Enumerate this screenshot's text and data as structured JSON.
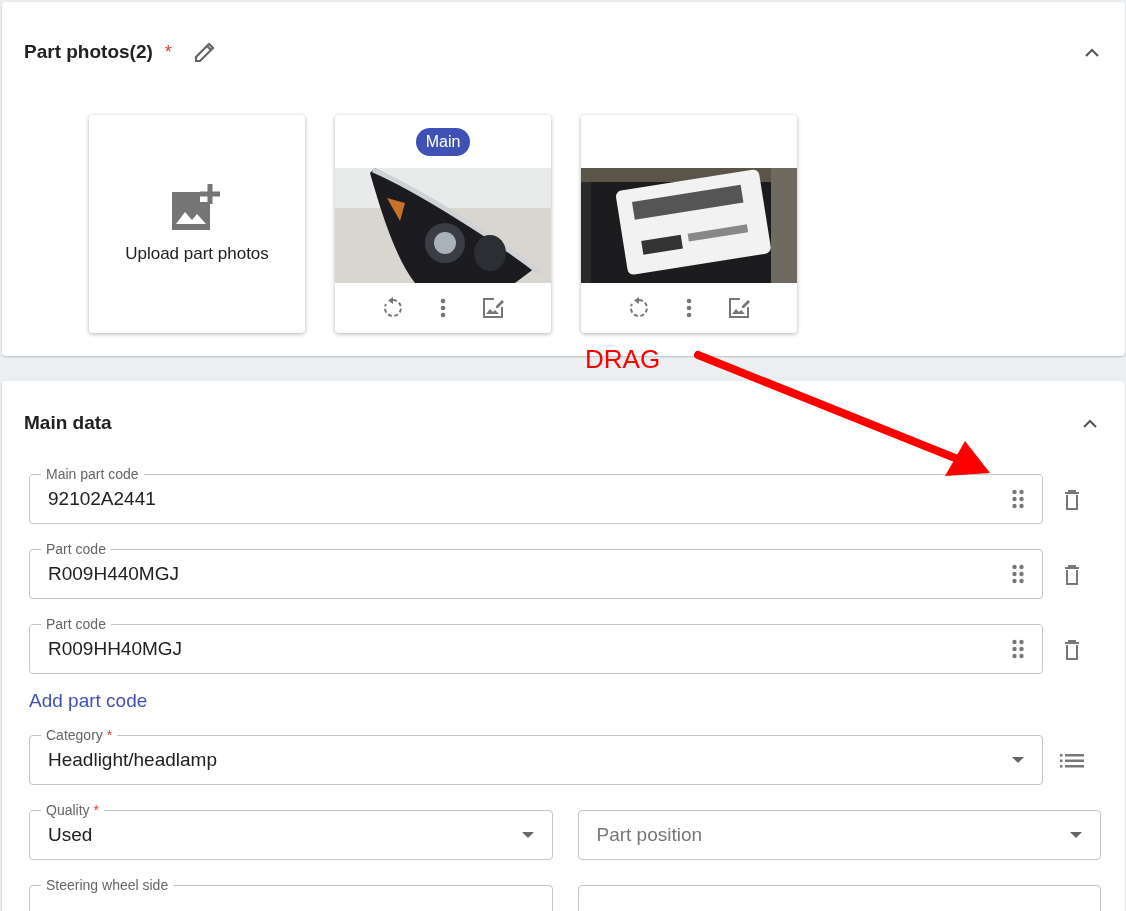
{
  "photos_section": {
    "title": "Part photos(2)",
    "required_mark": "*",
    "expanded": true,
    "upload_label": "Upload part photos",
    "photos": [
      {
        "badge": "Main",
        "kind": "headlight"
      },
      {
        "kind": "label"
      }
    ]
  },
  "annotation": {
    "text": "DRAG"
  },
  "main_section": {
    "title": "Main data",
    "expanded": true,
    "codes": [
      {
        "label": "Main part code",
        "value": "92102A2441"
      },
      {
        "label": "Part code",
        "value": "R009H440MGJ"
      },
      {
        "label": "Part code",
        "value": "R009HH40MGJ"
      }
    ],
    "add_link": "Add part code",
    "category": {
      "label": "Category",
      "required_mark": "*",
      "value": "Headlight/headlamp",
      "kind": "select"
    },
    "fields": [
      {
        "label": "Quality",
        "required_mark": "*",
        "value": "Used",
        "kind": "select"
      },
      {
        "placeholder": "Part position",
        "kind": "select"
      },
      {
        "label": "Steering wheel side",
        "kind": "text"
      },
      {
        "kind": "text"
      }
    ]
  }
}
